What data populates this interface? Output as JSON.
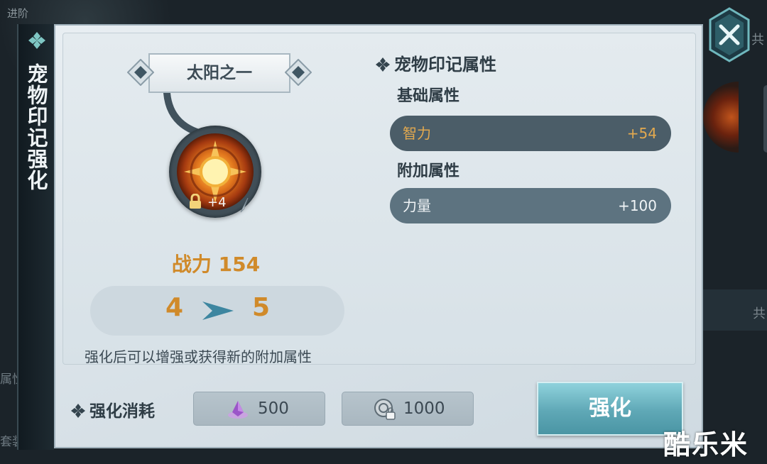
{
  "background": {
    "top_left_label": "进阶",
    "left_label_1": "属性加",
    "left_label_2": "套装效",
    "right_label_1": "共",
    "right_label_2": "共"
  },
  "side_tab": {
    "icon": "diamond-cluster-icon",
    "title": "宠物印记强化"
  },
  "close_button": {
    "icon": "close-x-icon"
  },
  "pet_mark": {
    "name": "太阳之一",
    "icon": "sun-emblem-icon",
    "lock_icon": "lock-icon",
    "level_badge": "+4",
    "power_text": "战力 154",
    "level_from": "4",
    "level_to": "5",
    "hint": "强化后可以增强或获得新的附加属性"
  },
  "attributes": {
    "section_title": "宠物印记属性",
    "base_title": "基础属性",
    "base": [
      {
        "label": "智力",
        "value": "+54"
      }
    ],
    "extra_title": "附加属性",
    "extra": [
      {
        "label": "力量",
        "value": "+100"
      }
    ]
  },
  "cost": {
    "title": "强化消耗",
    "items": [
      {
        "icon": "purple-crystal-icon",
        "value": "500"
      },
      {
        "icon": "locked-coin-icon",
        "value": "1000"
      }
    ]
  },
  "strengthen_button": {
    "label": "强化"
  },
  "watermark": "酷乐米",
  "colors": {
    "accent_orange": "#d08a2a",
    "base_attr_text": "#e3a94f",
    "button_teal": "#5fa8b6"
  }
}
